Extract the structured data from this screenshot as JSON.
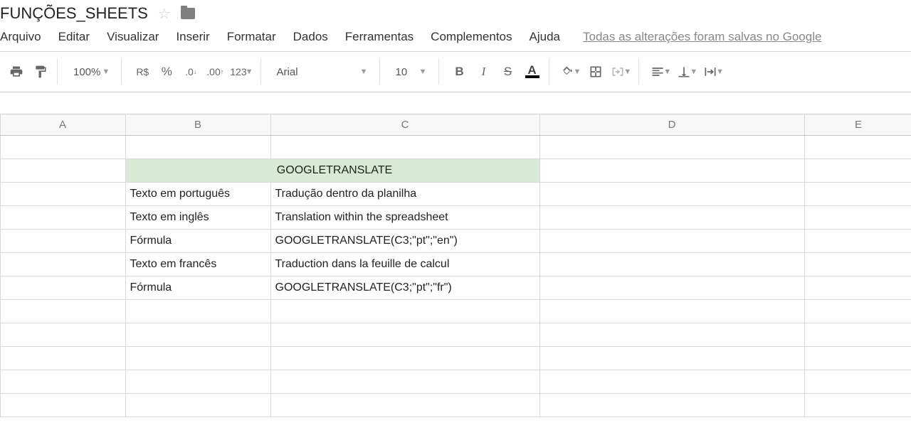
{
  "header": {
    "title": "FUNÇÕES_SHEETS"
  },
  "menubar": {
    "items": [
      "Arquivo",
      "Editar",
      "Visualizar",
      "Inserir",
      "Formatar",
      "Dados",
      "Ferramentas",
      "Complementos",
      "Ajuda"
    ],
    "save_status": "Todas as alterações foram salvas no Google"
  },
  "toolbar": {
    "zoom": "100%",
    "currency": "R$",
    "percent": "%",
    "dec_dec": ".0",
    "inc_dec": ".00",
    "format123": "123",
    "font": "Arial",
    "fontsize": "10",
    "bold": "B",
    "italic": "I",
    "strike": "S",
    "textcolor_letter": "A"
  },
  "columns": [
    "A",
    "B",
    "C",
    "D",
    "E"
  ],
  "cells": {
    "merged_bc_row2": "GOOGLETRANSLATE",
    "b3": "Texto em português",
    "c3": "Tradução dentro da planilha",
    "b4": "Texto em inglês",
    "c4": "Translation within the spreadsheet",
    "b5": "Fórmula",
    "c5": "GOOGLETRANSLATE(C3;\"pt\";\"en\")",
    "b6": "Texto em francês",
    "c6": "Traduction dans la feuille de calcul",
    "b7": "Fórmula",
    "c7": "GOOGLETRANSLATE(C3;\"pt\";\"fr\")"
  }
}
